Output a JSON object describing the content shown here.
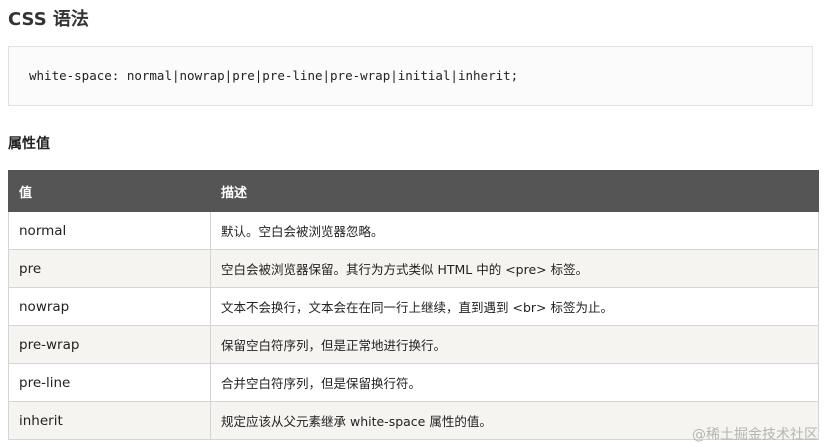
{
  "heading": "CSS 语法",
  "code": "white-space: normal|nowrap|pre|pre-line|pre-wrap|initial|inherit;",
  "subheading": "属性值",
  "table": {
    "headers": [
      "值",
      "描述"
    ],
    "rows": [
      {
        "value": "normal",
        "description": "默认。空白会被浏览器忽略。"
      },
      {
        "value": "pre",
        "description": "空白会被浏览器保留。其行为方式类似 HTML 中的 <pre> 标签。"
      },
      {
        "value": "nowrap",
        "description": "文本不会换行，文本会在在同一行上继续，直到遇到 <br> 标签为止。"
      },
      {
        "value": "pre-wrap",
        "description": "保留空白符序列，但是正常地进行换行。"
      },
      {
        "value": "pre-line",
        "description": "合并空白符序列，但是保留换行符。"
      },
      {
        "value": "inherit",
        "description": "规定应该从父元素继承 white-space 属性的值。"
      }
    ]
  },
  "watermark": "@稀土掘金技术社区"
}
